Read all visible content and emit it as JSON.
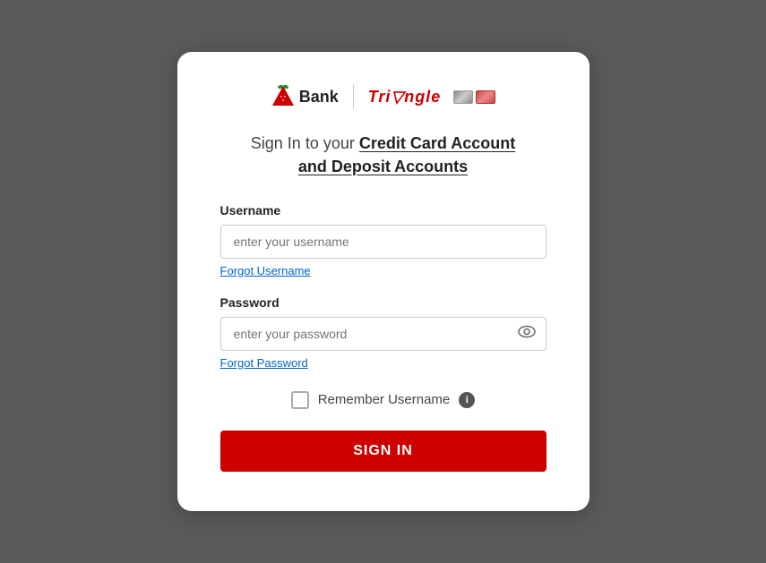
{
  "page": {
    "background_color": "#5a5a5a"
  },
  "logo": {
    "bank_label": "Bank",
    "divider": "|",
    "triangle_label": "Tri▽ngle"
  },
  "heading": {
    "line1_normal": "Sign In to your ",
    "line1_bold": "Credit Card Account",
    "line2": "and Deposit Accounts"
  },
  "form": {
    "username_label": "Username",
    "username_placeholder": "enter your username",
    "forgot_username": "Forgot Username",
    "password_label": "Password",
    "password_placeholder": "enter your password",
    "forgot_password": "Forgot Password",
    "remember_label": "Remember Username",
    "sign_in_button": "SIGN IN"
  }
}
